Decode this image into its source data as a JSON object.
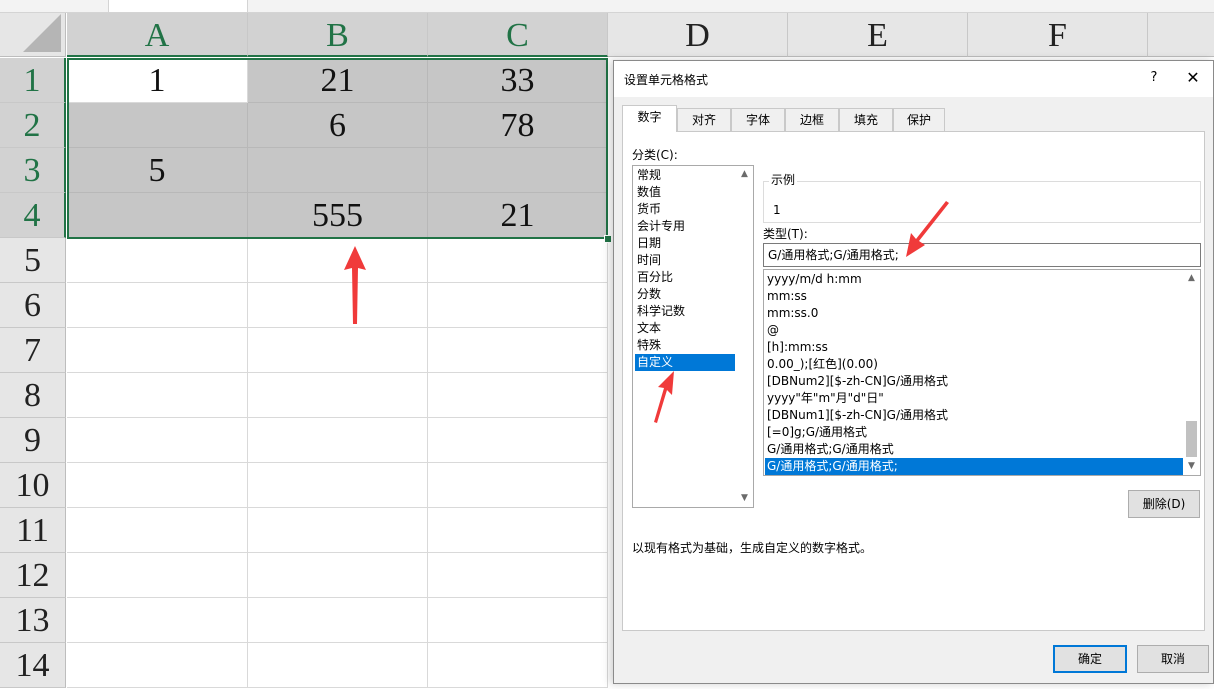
{
  "spreadsheet": {
    "columns": [
      "A",
      "B",
      "C",
      "D",
      "E",
      "F"
    ],
    "rows": [
      "1",
      "2",
      "3",
      "4",
      "5",
      "6",
      "7",
      "8",
      "9",
      "10",
      "11",
      "12",
      "13",
      "14"
    ],
    "cells": {
      "A1": "1",
      "B1": "21",
      "C1": "33",
      "A2": "",
      "B2": "6",
      "C2": "78",
      "A3": "5",
      "B3": "",
      "C3": "",
      "A4": "",
      "B4": "555",
      "C4": "21"
    },
    "selection_range": "A1:C4",
    "selection_color": "#217346",
    "selection_fill": "#c6c6c6"
  },
  "dialog": {
    "title": "设置单元格格式",
    "help_label": "?",
    "close_label": "✕",
    "tabs": [
      "数字",
      "对齐",
      "字体",
      "边框",
      "填充",
      "保护"
    ],
    "active_tab": "数字",
    "category_label": "分类(C):",
    "categories": [
      "常规",
      "数值",
      "货币",
      "会计专用",
      "日期",
      "时间",
      "百分比",
      "分数",
      "科学记数",
      "文本",
      "特殊",
      "自定义"
    ],
    "selected_category": "自定义",
    "sample_label": "示例",
    "sample_value": "1",
    "type_label": "类型(T):",
    "type_value": "G/通用格式;G/通用格式;",
    "formats": [
      "yyyy/m/d h:mm",
      "mm:ss",
      "mm:ss.0",
      "@",
      "[h]:mm:ss",
      "0.00_);[红色](0.00)",
      "[DBNum2][$-zh-CN]G/通用格式",
      "yyyy\"年\"m\"月\"d\"日\"",
      "[DBNum1][$-zh-CN]G/通用格式",
      "[=0]g;G/通用格式",
      "G/通用格式;G/通用格式",
      "G/通用格式;G/通用格式;"
    ],
    "selected_format": "G/通用格式;G/通用格式;",
    "delete_button": "删除(D)",
    "description": "以现有格式为基础，生成自定义的数字格式。",
    "ok_button": "确定",
    "cancel_button": "取消",
    "accent_color": "#0078d7"
  },
  "annotations": {
    "arrow_color": "#f03a3a"
  }
}
